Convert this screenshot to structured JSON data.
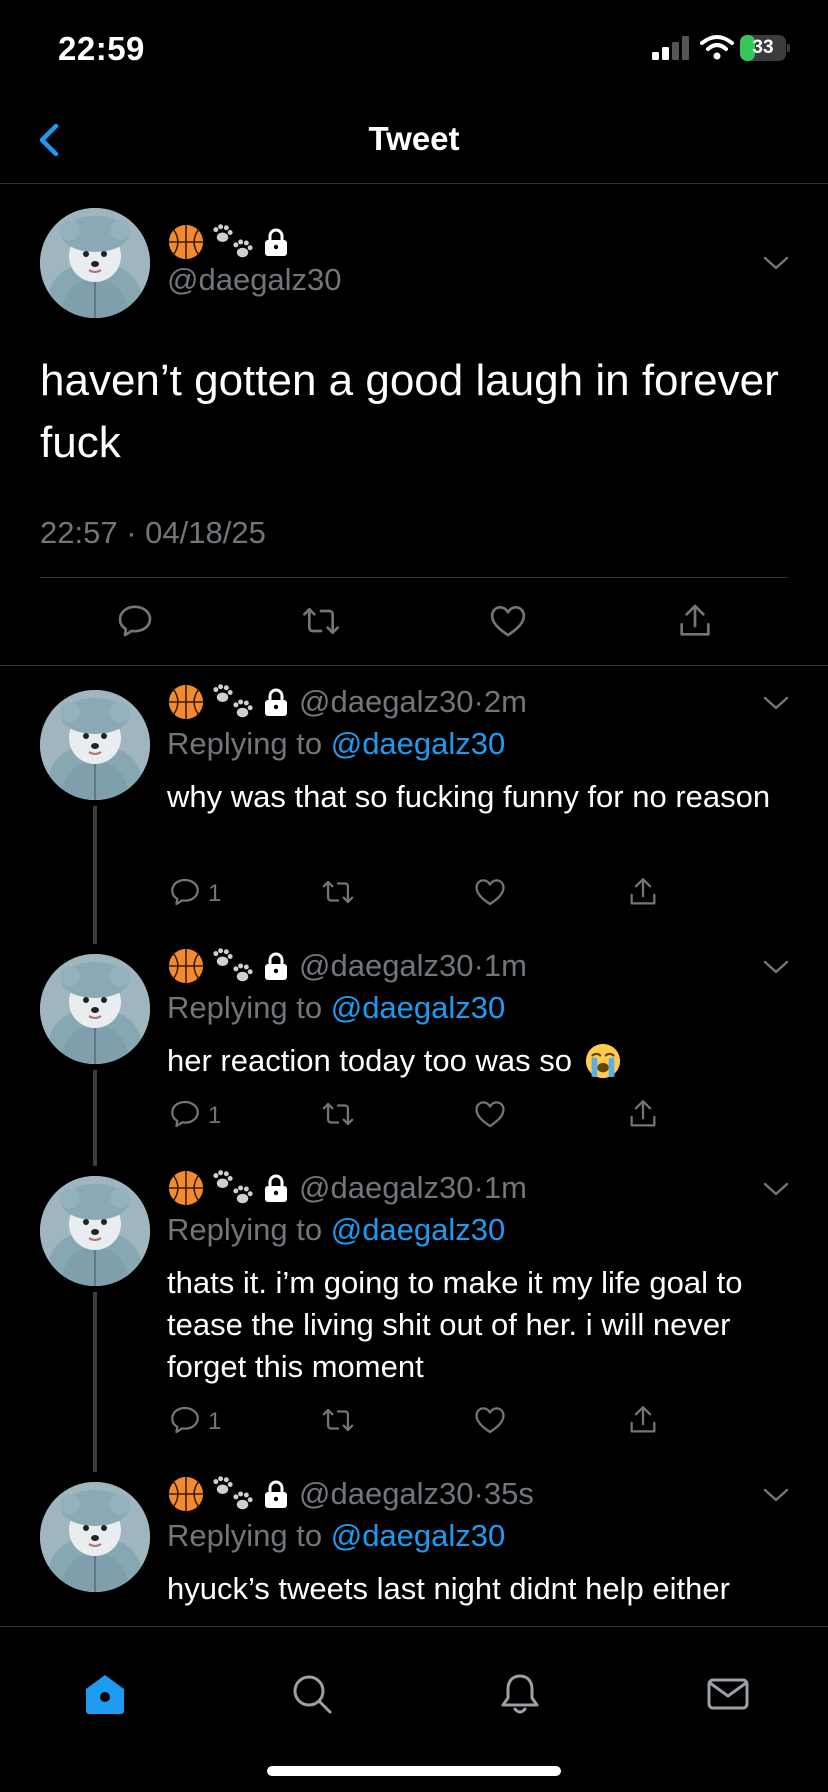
{
  "status_bar": {
    "time": "22:59",
    "battery_level": "33",
    "battery_fraction": 0.33
  },
  "nav": {
    "title": "Tweet"
  },
  "main_tweet": {
    "handle": "@daegalz30",
    "text": "haven’t gotten a good laugh in forever fuck",
    "time": "22:57",
    "date": "04/18/25",
    "meta_sep": " · "
  },
  "replies": [
    {
      "handle": "@daegalz30",
      "time": "2m",
      "replying_prefix": "Replying to ",
      "mention": "@daegalz30",
      "text": "why was that so fucking funny for no reason",
      "reply_count": "1"
    },
    {
      "handle": "@daegalz30",
      "time": "1m",
      "replying_prefix": "Replying to ",
      "mention": "@daegalz30",
      "text": "her reaction today too was so",
      "emoji": "loudly-crying-face",
      "reply_count": "1"
    },
    {
      "handle": "@daegalz30",
      "time": "1m",
      "replying_prefix": "Replying to ",
      "mention": "@daegalz30",
      "text": "thats it. i’m going to make it my life goal to tease the living shit out of her. i will never forget this moment",
      "reply_count": "1"
    },
    {
      "handle": "@daegalz30",
      "time": "35s",
      "replying_prefix": "Replying to ",
      "mention": "@daegalz30",
      "text": "hyuck’s tweets last night didnt help either"
    }
  ],
  "header_sep": " · ",
  "colors": {
    "accent": "#1d9bf0",
    "muted": "#71767b",
    "background": "#000000",
    "divider": "#2f3336"
  },
  "tabs": [
    {
      "name": "home-tab",
      "icon": "home-icon",
      "active": true
    },
    {
      "name": "search-tab",
      "icon": "search-icon",
      "active": false
    },
    {
      "name": "notifications-tab",
      "icon": "bell-icon",
      "active": false
    },
    {
      "name": "messages-tab",
      "icon": "mail-icon",
      "active": false
    }
  ]
}
